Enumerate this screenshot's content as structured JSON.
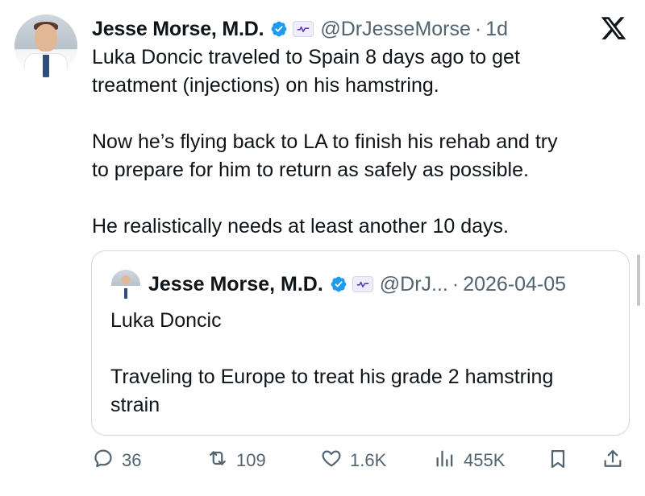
{
  "tweet": {
    "author_name": "Jesse Morse, M.D.",
    "handle": "@DrJesseMorse",
    "separator": "·",
    "time": "1d",
    "text": "Luka Doncic traveled to Spain 8 days ago to get\ntreatment (injections) on his hamstring.\n\nNow he’s flying back to LA to finish his rehab and try\nto prepare for him to return as safely as possible.\n\nHe realistically needs at least another 10 days."
  },
  "quote": {
    "author_name": "Jesse Morse, M.D.",
    "handle": "@DrJ...",
    "separator": "·",
    "date": "2026-04-05",
    "text": "Luka Doncic\n\nTraveling to Europe to treat his grade 2 hamstring\nstrain"
  },
  "actions": {
    "replies": "36",
    "reposts": "109",
    "likes": "1.6K",
    "views": "455K"
  },
  "icons": {
    "verified": "verified-badge-icon",
    "affiliate": "affiliate-badge-icon",
    "platform": "x-logo-icon",
    "reply": "reply-icon",
    "repost": "repost-icon",
    "like": "heart-icon",
    "views": "views-icon",
    "bookmark": "bookmark-icon",
    "share": "share-icon"
  },
  "colors": {
    "verified_blue": "#1d9bf0",
    "text": "#0f1419",
    "secondary_text": "#536471",
    "border": "#cfd9de"
  }
}
